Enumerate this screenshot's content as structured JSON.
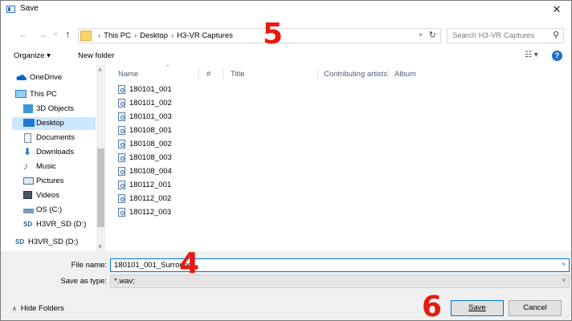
{
  "window": {
    "title": "Save",
    "close": "✕"
  },
  "address": {
    "crumbs": [
      "This PC",
      "Desktop",
      "H3-VR Captures"
    ],
    "search_placeholder": "Search H3-VR Captures"
  },
  "toolbar": {
    "organize": "Organize ▾",
    "new_folder": "New folder"
  },
  "nav": {
    "items": [
      {
        "label": "OneDrive"
      },
      {
        "label": "This PC"
      },
      {
        "label": "3D Objects"
      },
      {
        "label": "Desktop"
      },
      {
        "label": "Documents"
      },
      {
        "label": "Downloads"
      },
      {
        "label": "Music"
      },
      {
        "label": "Pictures"
      },
      {
        "label": "Videos"
      },
      {
        "label": "OS (C:)"
      },
      {
        "label": "H3VR_SD (D:)"
      },
      {
        "label": "H3VR_SD (D:)"
      }
    ]
  },
  "columns": [
    "Name",
    "#",
    "Title",
    "Contributing artists",
    "Album"
  ],
  "files": [
    "180101_001",
    "180101_002",
    "180101_003",
    "180108_001",
    "180108_002",
    "180108_003",
    "180108_004",
    "180112_001",
    "180112_002",
    "180112_003"
  ],
  "form": {
    "file_name_label": "File name:",
    "file_name_value": "180101_001_Surround",
    "save_type_label": "Save as type:",
    "save_type_value": "*.wav;",
    "hide_folders": "Hide Folders",
    "save": "Save",
    "cancel": "Cancel"
  },
  "annotations": [
    "5",
    "4",
    "6"
  ],
  "colors": {
    "annotation": "#e31b10",
    "selection": "#cce8ff",
    "accent": "#0078d7"
  }
}
